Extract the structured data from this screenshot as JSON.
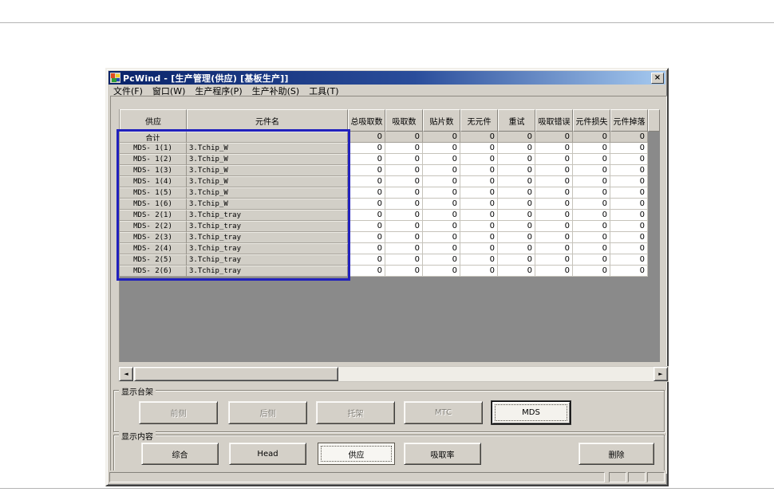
{
  "window": {
    "title": "PcWind - [生产管理(供应) [基板生产]]"
  },
  "icons": {
    "close": "×",
    "scroll_left": "◄",
    "scroll_right": "►"
  },
  "menu": {
    "items": [
      "文件(F)",
      "窗口(W)",
      "生产程序(P)",
      "生产补助(S)",
      "工具(T)"
    ]
  },
  "table": {
    "columns": [
      "供应",
      "元件名",
      "总吸取数",
      "吸取数",
      "贴片数",
      "无元件",
      "重试",
      "吸取错误",
      "元件损失",
      "元件掉落"
    ],
    "rows": [
      {
        "supply": "合计",
        "component": "",
        "values": [
          "0",
          "0",
          "0",
          "0",
          "0",
          "0",
          "0",
          "0"
        ],
        "is_total": true
      },
      {
        "supply": "MDS- 1(1)",
        "component": "3.Tchip_W",
        "values": [
          "0",
          "0",
          "0",
          "0",
          "0",
          "0",
          "0",
          "0"
        ]
      },
      {
        "supply": "MDS- 1(2)",
        "component": "3.Tchip_W",
        "values": [
          "0",
          "0",
          "0",
          "0",
          "0",
          "0",
          "0",
          "0"
        ]
      },
      {
        "supply": "MDS- 1(3)",
        "component": "3.Tchip_W",
        "values": [
          "0",
          "0",
          "0",
          "0",
          "0",
          "0",
          "0",
          "0"
        ]
      },
      {
        "supply": "MDS- 1(4)",
        "component": "3.Tchip_W",
        "values": [
          "0",
          "0",
          "0",
          "0",
          "0",
          "0",
          "0",
          "0"
        ]
      },
      {
        "supply": "MDS- 1(5)",
        "component": "3.Tchip_W",
        "values": [
          "0",
          "0",
          "0",
          "0",
          "0",
          "0",
          "0",
          "0"
        ]
      },
      {
        "supply": "MDS- 1(6)",
        "component": "3.Tchip_W",
        "values": [
          "0",
          "0",
          "0",
          "0",
          "0",
          "0",
          "0",
          "0"
        ]
      },
      {
        "supply": "MDS- 2(1)",
        "component": "3.Tchip_tray",
        "values": [
          "0",
          "0",
          "0",
          "0",
          "0",
          "0",
          "0",
          "0"
        ]
      },
      {
        "supply": "MDS- 2(2)",
        "component": "3.Tchip_tray",
        "values": [
          "0",
          "0",
          "0",
          "0",
          "0",
          "0",
          "0",
          "0"
        ]
      },
      {
        "supply": "MDS- 2(3)",
        "component": "3.Tchip_tray",
        "values": [
          "0",
          "0",
          "0",
          "0",
          "0",
          "0",
          "0",
          "0"
        ]
      },
      {
        "supply": "MDS- 2(4)",
        "component": "3.Tchip_tray",
        "values": [
          "0",
          "0",
          "0",
          "0",
          "0",
          "0",
          "0",
          "0"
        ]
      },
      {
        "supply": "MDS- 2(5)",
        "component": "3.Tchip_tray",
        "values": [
          "0",
          "0",
          "0",
          "0",
          "0",
          "0",
          "0",
          "0"
        ]
      },
      {
        "supply": "MDS- 2(6)",
        "component": "3.Tchip_tray",
        "values": [
          "0",
          "0",
          "0",
          "0",
          "0",
          "0",
          "0",
          "0"
        ]
      }
    ],
    "highlight_color": "#2121bd"
  },
  "groups": {
    "stand": {
      "label": "显示台架",
      "buttons": [
        {
          "label": "前侧",
          "name": "front-side-button",
          "state": "disabled"
        },
        {
          "label": "后侧",
          "name": "rear-side-button",
          "state": "disabled"
        },
        {
          "label": "托架",
          "name": "bracket-button",
          "state": "disabled"
        },
        {
          "label": "MTC",
          "name": "mtc-button",
          "state": "disabled"
        },
        {
          "label": "MDS",
          "name": "mds-button",
          "state": "default"
        }
      ]
    },
    "content": {
      "label": "显示内容",
      "buttons": [
        {
          "label": "综合",
          "name": "overall-button",
          "state": "normal"
        },
        {
          "label": "Head",
          "name": "head-button",
          "state": "normal"
        },
        {
          "label": "供应",
          "name": "supply-button",
          "state": "selected"
        },
        {
          "label": "吸取率",
          "name": "pickup-rate-button",
          "state": "normal"
        },
        {
          "label": "删除",
          "name": "delete-button",
          "state": "normal"
        }
      ]
    }
  },
  "colors": {
    "titlebar_start": "#0a246a",
    "titlebar_end": "#a6caf0",
    "window_face": "#d4d0c8",
    "table_empty_area": "#8a8a8a"
  }
}
